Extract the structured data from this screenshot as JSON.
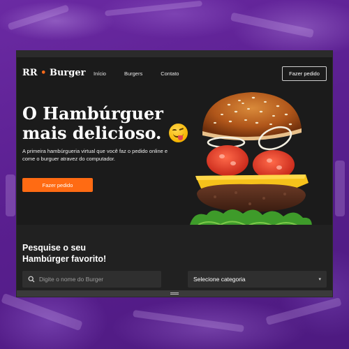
{
  "brand": {
    "prefix": "RR",
    "name": "Burger",
    "accent": "#ff6b13"
  },
  "nav": {
    "items": [
      "Início",
      "Burgers",
      "Contato"
    ]
  },
  "header": {
    "order_button": "Fazer pedido"
  },
  "hero": {
    "title_line1": "O Hambúrguer",
    "title_line2": "mais delicioso.",
    "emoji": "savoring-face-emoji",
    "subtitle": "A primeira hambúrgueria virtual que você faz o pedido online e come o burguer atravez do computador.",
    "cta": "Fazer pedido",
    "image": "burger-illustration"
  },
  "search": {
    "title": "Pesquise o seu Hambúrger favorito!",
    "placeholder": "Digite o nome do Burger",
    "icon": "search-icon",
    "category_selected": "Selecione categoria",
    "category_icon": "chevron-down-icon"
  },
  "colors": {
    "background": "#1b1b1b",
    "panel": "#212121",
    "input": "#2f2f2f",
    "accent": "#ff6b13",
    "backdrop": "#5a1f8f"
  }
}
